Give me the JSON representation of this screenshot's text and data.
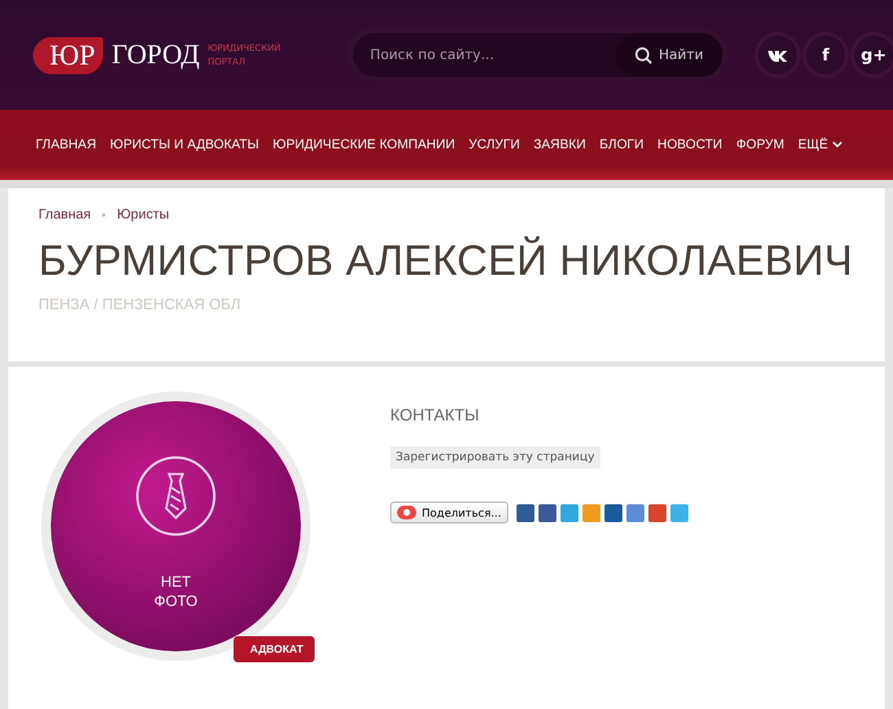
{
  "header": {
    "logo_mark": "ЮР",
    "logo_text": "ГОРОД",
    "tagline": "ЮРИДИЧЕСКИЙ ПОРТАЛ",
    "search": {
      "placeholder": "Поиск по сайту...",
      "button": "Найти"
    },
    "social": [
      "f",
      "g+"
    ]
  },
  "nav": {
    "items": [
      "ГЛАВНАЯ",
      "ЮРИСТЫ И АДВОКАТЫ",
      "ЮРИДИЧЕСКИЕ КОМПАНИИ",
      "УСЛУГИ",
      "ЗАЯВКИ",
      "БЛОГИ",
      "НОВОСТИ",
      "ФОРУМ"
    ],
    "more": "ЕЩЁ"
  },
  "breadcrumbs": [
    "Главная",
    "Юристы"
  ],
  "title": "БУРМИСТРОВ АЛЕКСЕЙ НИКОЛАЕВИЧ",
  "location": "ПЕНЗА / ПЕНЗЕНСКАЯ ОБЛ",
  "profile": {
    "photo_text": "НЕТ ФОТО",
    "tag": "АДВОКАТ"
  },
  "contacts": {
    "heading": "КОНТАКТЫ",
    "register_button": "Зарегистрировать эту страницу",
    "share_button": "Поделиться..."
  }
}
